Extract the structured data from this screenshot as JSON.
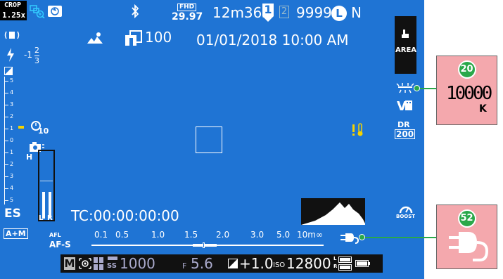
{
  "top": {
    "crop": "CROP",
    "crop_factor": "1.25x",
    "fhd": "FHD",
    "fps": "29.97",
    "rec_time": "12m36s",
    "slot_active": "1",
    "slot_inactive": "2",
    "frames": "9999",
    "size": "L",
    "quality": "N",
    "copies": "100",
    "datetime": "01/01/2018 10:00 AM"
  },
  "left": {
    "flash_comp": "-1",
    "flash_frac_num": "2",
    "flash_frac_den": "3",
    "scale_labels": [
      "5",
      "4",
      "3",
      "2",
      "1",
      "0",
      "1",
      "2",
      "3",
      "4",
      "5"
    ],
    "timer": "10",
    "ibis": "H",
    "shutter_type": "ES",
    "focus_mode": "A+M",
    "audio_l": "L",
    "audio_r": "R"
  },
  "right": {
    "af_mode": "AREA",
    "film_sim": "V",
    "dr_label": "DR",
    "dr_value": "200",
    "boost": "BOOST"
  },
  "timecode": "TC:00:00:00:00",
  "distance": {
    "afl": "AFL",
    "af_mode": "AF-S",
    "labels": [
      "0.1",
      "0.5",
      "1.0",
      "1.5",
      "2.0",
      "3.0",
      "5.0",
      "10m∞"
    ]
  },
  "bottom": {
    "mode": "M",
    "ss_prefix": "SS",
    "shutter": "1000",
    "f_prefix": "F",
    "aperture": "5.6",
    "exp_comp": "+1.0",
    "iso_prefix": "ISO",
    "iso": "12800",
    "battery_l": "L",
    "battery_r": "R"
  },
  "callouts": {
    "wb": {
      "number": "20",
      "value": "10000",
      "unit": "K"
    },
    "power": {
      "number": "52"
    }
  },
  "colors": {
    "screen_bg": "#1f74d4",
    "callout_bg": "#f4a8ad",
    "callout_badge": "#2aa84a",
    "warning_yellow": "#f5d300"
  }
}
